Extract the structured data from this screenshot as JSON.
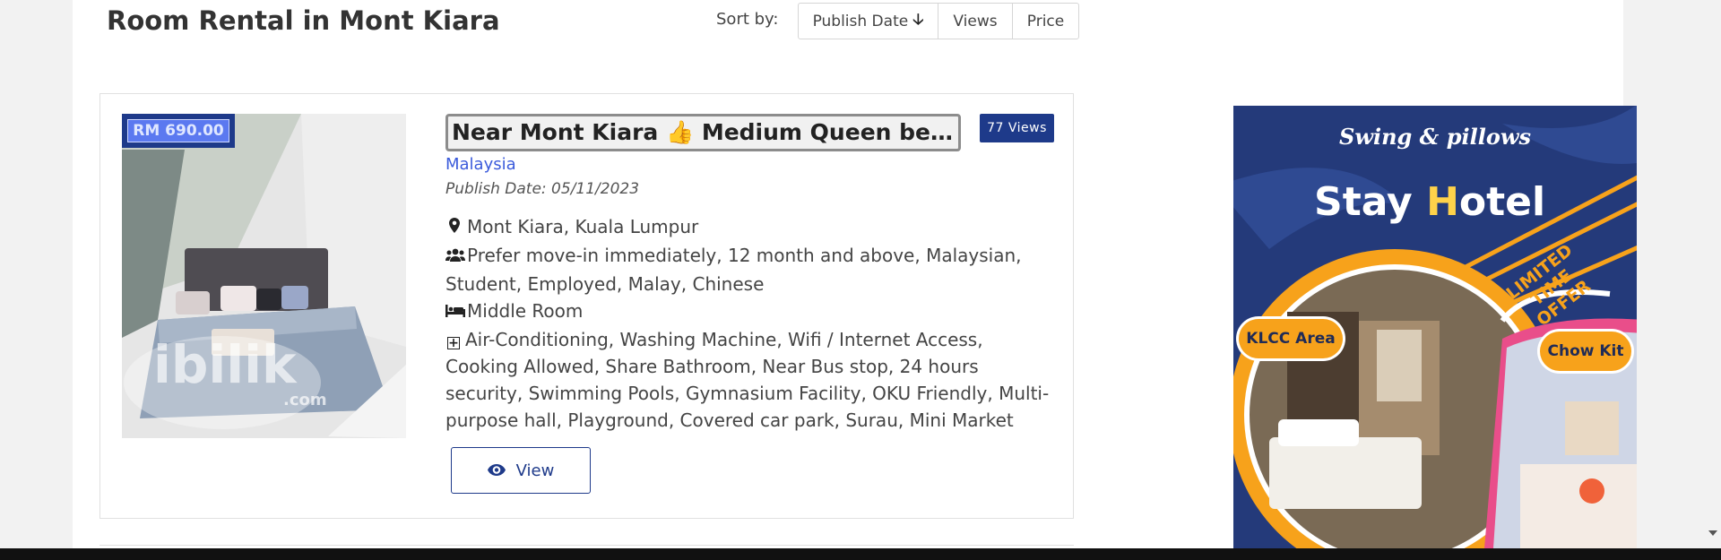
{
  "header": {
    "title": "Room Rental in Mont Kiara",
    "sort_label": "Sort by:",
    "sort_options": [
      {
        "label": "Publish Date",
        "active": true
      },
      {
        "label": "Views",
        "active": false
      },
      {
        "label": "Price",
        "active": false
      }
    ]
  },
  "listing": {
    "price": "RM 690.00",
    "title": "Near Mont Kiara 👍 Medium Queen bedroom",
    "views": "77 Views",
    "country": "Malaysia",
    "publish_date": "Publish Date: 05/11/2023",
    "location": "Mont Kiara, Kuala Lumpur",
    "preferences": "Prefer move-in immediately, 12 month and above, Malaysian, Student, Employed, Malay, Chinese",
    "room_type": "Middle Room",
    "facilities": "Air-Conditioning, Washing Machine, Wifi / Internet Access, Cooking Allowed, Share Bathroom, Near Bus stop, 24 hours security, Swimming Pools, Gymnasium Facility, OKU Friendly, Multi-purpose hall, Playground, Covered car park, Surau, Mini Market",
    "view_button": "View",
    "photo_watermark": "ibilik",
    "photo_watermark_sub": ".com"
  },
  "ad": {
    "brand": "Swing & pillows",
    "hotel_name_first": "Stay ",
    "hotel_name_h": "H",
    "hotel_name_rest": "otel",
    "offer_line1": "LIMITED",
    "offer_line2": "TIME",
    "offer_line3": "OFFER",
    "pill_left": "KLCC Area",
    "pill_right": "Chow Kit"
  },
  "colors": {
    "accent": "#1e3a8a",
    "link": "#3b5bdb",
    "ad_background": "#243a7a",
    "ad_orange": "#f7a21b"
  }
}
